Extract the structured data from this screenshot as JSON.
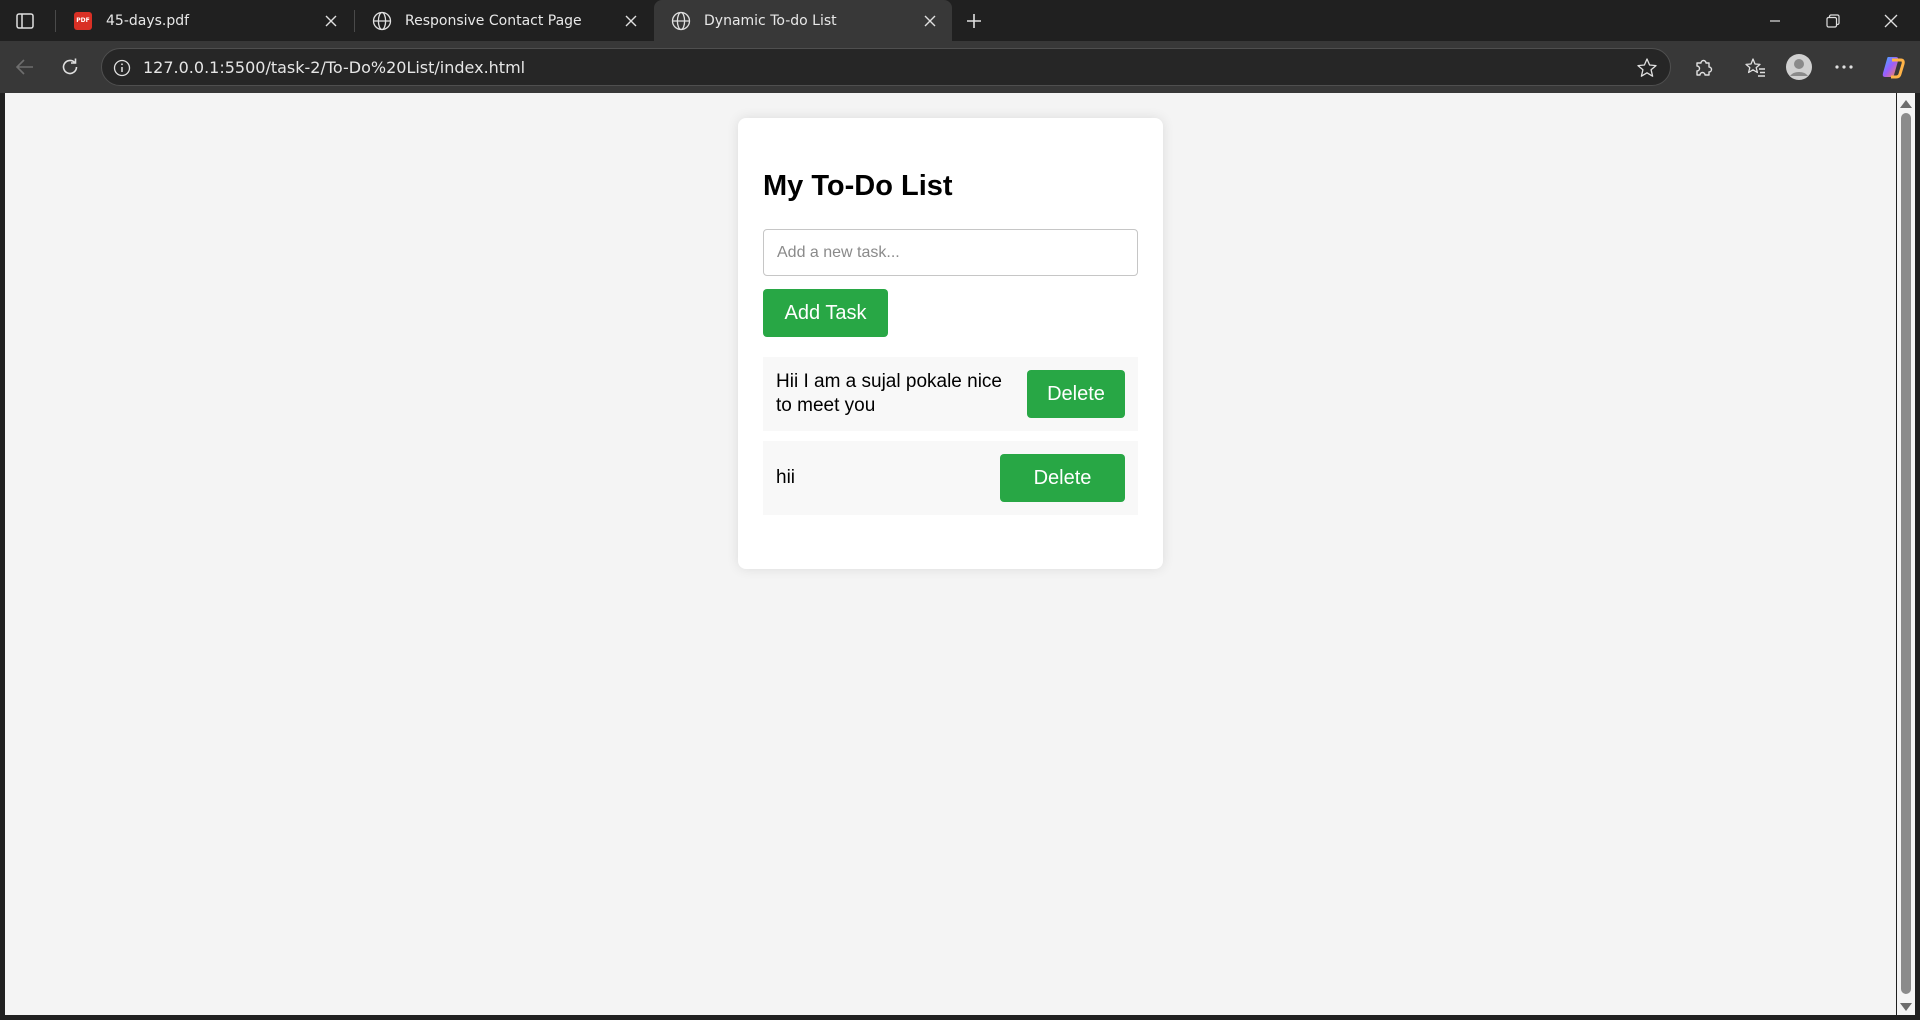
{
  "browser": {
    "tabs": [
      {
        "title": "45-days.pdf",
        "icon": "pdf-icon",
        "active": false
      },
      {
        "title": "Responsive Contact Page",
        "icon": "globe-icon",
        "active": false
      },
      {
        "title": "Dynamic To-do List",
        "icon": "globe-icon",
        "active": true
      }
    ],
    "address_bar": {
      "url": "127.0.0.1:5500/task-2/To-Do%20List/index.html"
    },
    "pdf_badge_text": "PDF"
  },
  "page": {
    "heading": "My To-Do List",
    "input": {
      "placeholder": "Add a new task...",
      "value": ""
    },
    "add_button_label": "Add Task",
    "tasks": [
      {
        "text": "Hii I am a sujal pokale nice to meet you",
        "delete_label": "Delete"
      },
      {
        "text": "hii",
        "delete_label": "Delete"
      }
    ],
    "accent_color": "#28a745"
  }
}
